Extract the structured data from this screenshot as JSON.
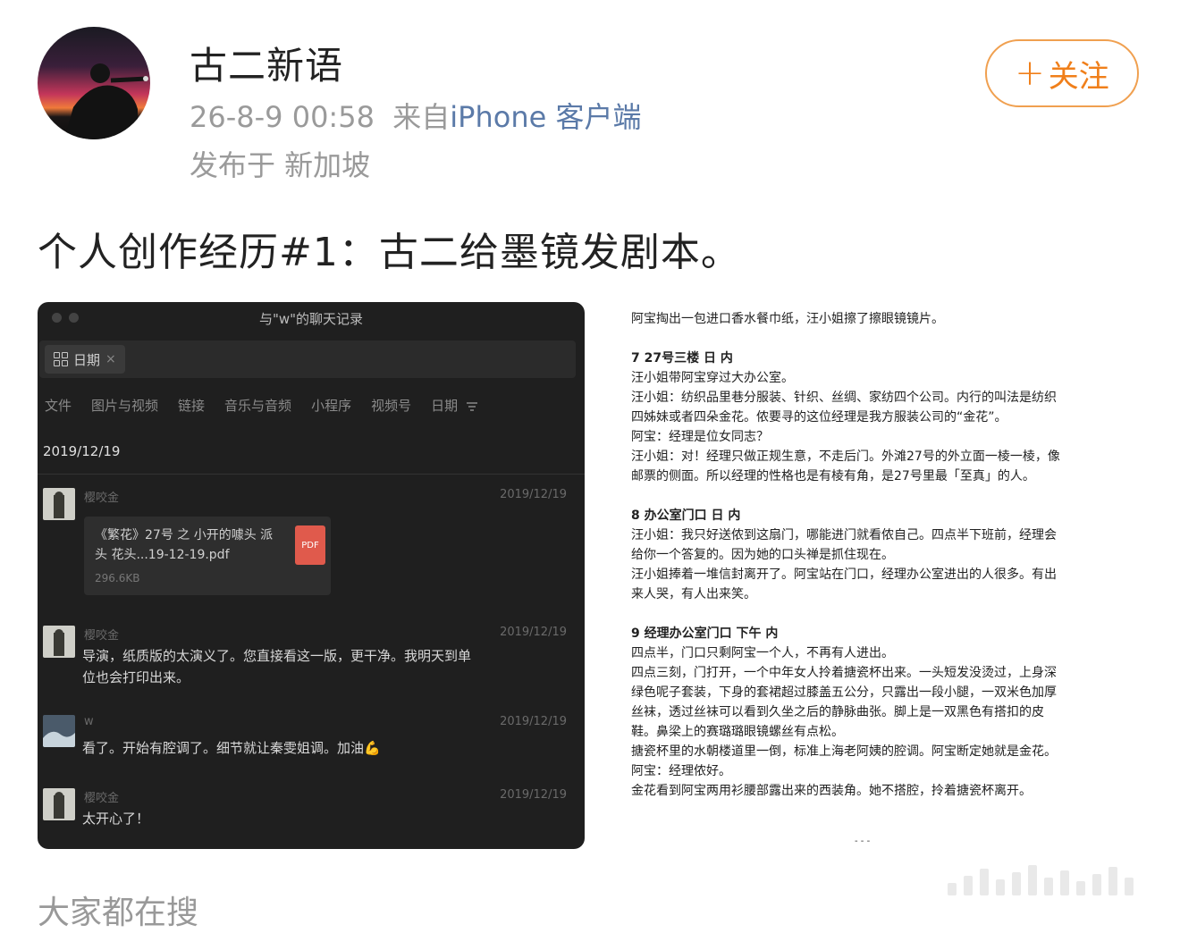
{
  "user": {
    "name": "古二新语",
    "timestamp": "26-8-9 00:58",
    "source_prefix": "来自",
    "source": "iPhone 客户端",
    "location": "发布于 新加坡"
  },
  "follow": {
    "plus": "+",
    "label": "关注"
  },
  "post": {
    "text": "个人创作经历#1：古二给墨镜发剧本。"
  },
  "chat": {
    "window_title": "与\"w\"的聊天记录",
    "search_chip": "日期",
    "search_chip_close": "×",
    "tabs": [
      "文件",
      "图片与视频",
      "链接",
      "音乐与音频",
      "小程序",
      "视频号",
      "日期"
    ],
    "date_header": "2019/12/19",
    "messages": [
      {
        "name": "樱咬金",
        "time": "2019/12/19",
        "text": ""
      },
      {
        "name": "樱咬金",
        "time": "2019/12/19",
        "text": "导演，纸质版的太演义了。您直接看这一版，更干净。我明天到单位也会打印出来。"
      },
      {
        "name": "w",
        "time": "2019/12/19",
        "text": "看了。开始有腔调了。细节就让秦雯姐调。加油💪"
      },
      {
        "name": "樱咬金",
        "time": "2019/12/19",
        "text": "太开心了！"
      }
    ],
    "file": {
      "name": "《繁花》27号 之 小开的噱头 派头 花头...19-12-19.pdf",
      "size": "296.6KB",
      "badge": "PDF"
    }
  },
  "doc": {
    "lines": [
      {
        "text": "阿宝掏出一包进口香水餐巾纸，汪小姐擦了擦眼镜镜片。",
        "head": false
      },
      {
        "text": "7 27号三楼 日 内",
        "head": true
      },
      {
        "text": "汪小姐带阿宝穿过大办公室。",
        "head": false
      },
      {
        "text": "汪小姐：纺织品里巷分服装、针织、丝绸、家纺四个公司。内行的叫法是纺织",
        "head": false
      },
      {
        "text": "四姊妹或者四朵金花。侬要寻的这位经理是我方服装公司的“金花”。",
        "head": false
      },
      {
        "text": "阿宝：经理是位女同志？",
        "head": false
      },
      {
        "text": "汪小姐：对！经理只做正规生意，不走后门。外滩27号的外立面一棱一棱，像",
        "head": false
      },
      {
        "text": "邮票的侧面。所以经理的性格也是有棱有角，是27号里最「至真」的人。",
        "head": false
      },
      {
        "text": "8 办公室门口 日 内",
        "head": true
      },
      {
        "text": "汪小姐：我只好送侬到这扇门，哪能进门就看侬自己。四点半下班前，经理会",
        "head": false
      },
      {
        "text": "给你一个答复的。因为她的口头禅是抓住现在。",
        "head": false
      },
      {
        "text": "汪小姐捧着一堆信封离开了。阿宝站在门口，经理办公室进出的人很多。有出",
        "head": false
      },
      {
        "text": "来人哭，有人出来笑。",
        "head": false
      },
      {
        "text": "9 经理办公室门口 下午 内",
        "head": true
      },
      {
        "text": "四点半，门口只剩阿宝一个人，不再有人进出。",
        "head": false
      },
      {
        "text": "四点三刻，门打开，一个中年女人拎着搪瓷杯出来。一头短发没烫过，上身深",
        "head": false
      },
      {
        "text": "绿色呢子套装，下身的套裙超过膝盖五公分，只露出一段小腿，一双米色加厚",
        "head": false
      },
      {
        "text": "丝袜，透过丝袜可以看到久坐之后的静脉曲张。脚上是一双黑色有搭扣的皮",
        "head": false
      },
      {
        "text": "鞋。鼻梁上的赛璐璐眼镜螺丝有点松。",
        "head": false
      },
      {
        "text": "搪瓷杯里的水朝楼道里一倒，标准上海老阿姨的腔调。阿宝断定她就是金花。",
        "head": false
      },
      {
        "text": "阿宝：经理侬好。",
        "head": false
      },
      {
        "text": "金花看到阿宝两用衫腰部露出来的西装角。她不搭腔，拎着搪瓷杯离开。",
        "head": false
      }
    ]
  },
  "next_section": {
    "text": "大家都在搜"
  }
}
